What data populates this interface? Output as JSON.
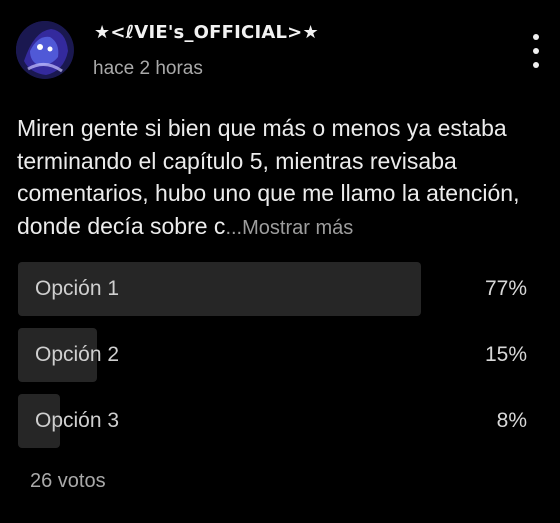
{
  "post": {
    "username": "★<ℓVIE's_OFFICIAL>★",
    "timestamp": "hace 2 horas",
    "text": "Miren gente si bien que más o menos ya estaba terminando el capítulo 5, mientras revisaba comentarios, hubo uno que me llamo la atención, donde decía sobre c",
    "show_more": "...Mostrar más"
  },
  "poll": {
    "options": [
      {
        "label": "Opción 1",
        "percent_text": "77%",
        "percent": 77
      },
      {
        "label": "Opción 2",
        "percent_text": "15%",
        "percent": 15
      },
      {
        "label": "Opción 3",
        "percent_text": "8%",
        "percent": 8
      }
    ],
    "votes": "26 votos"
  },
  "colors": {
    "background": "#000000",
    "fill": "#262626",
    "secondary_text": "#a9a9a9"
  },
  "icons": {
    "avatar": "user-avatar",
    "menu": "more-vertical-icon"
  }
}
